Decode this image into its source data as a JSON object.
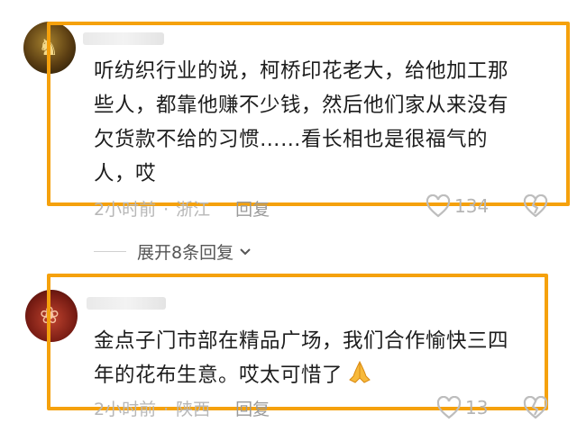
{
  "comments": [
    {
      "text_lines": [
        "听纺织行业的说，柯桥印花老大，给他加工那",
        "些人，都靠他赚不少钱，然后他们家从来没有",
        "欠货款不给的习惯……看长相也是很福气的",
        "人，哎"
      ],
      "time": "2小时前",
      "location": "浙江",
      "reply_label": "回复",
      "like_count": "134"
    },
    {
      "text_lines": [
        "金点子门市部在精品广场，我们合作愉快三四",
        "年的花布生意。哎太可惜了"
      ],
      "time": "2小时前",
      "location": "陕西",
      "reply_label": "回复",
      "like_count": "13"
    }
  ],
  "expand_replies": "展开8条回复",
  "colors": {
    "highlight_frame": "#f5a10c",
    "meta_text": "#b7b7b7"
  },
  "icons": {
    "like": "heart-outline-icon",
    "dislike": "broken-heart-icon",
    "expand": "chevron-down-icon",
    "emoji": "praying-hands-icon"
  }
}
